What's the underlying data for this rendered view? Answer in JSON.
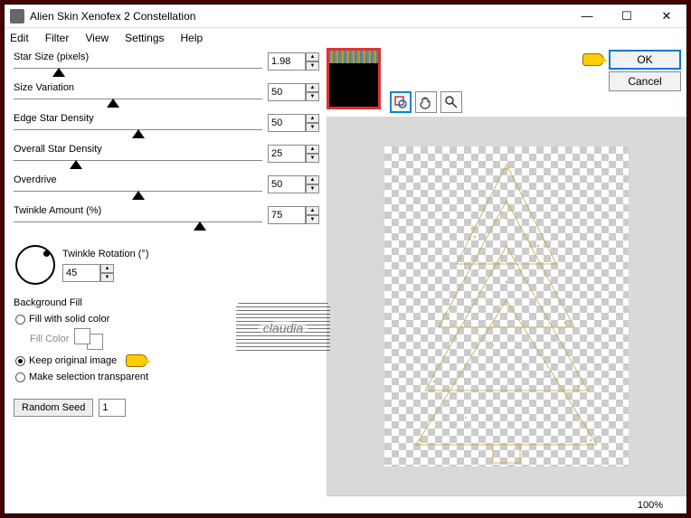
{
  "window": {
    "title": "Alien Skin Xenofex 2 Constellation"
  },
  "menu": {
    "items": [
      "Edit",
      "Filter",
      "View",
      "Settings",
      "Help"
    ]
  },
  "sliders": [
    {
      "label": "Star Size (pixels)",
      "value": "1.98",
      "pos": 18
    },
    {
      "label": "Size Variation",
      "value": "50",
      "pos": 40
    },
    {
      "label": "Edge Star Density",
      "value": "50",
      "pos": 50
    },
    {
      "label": "Overall Star Density",
      "value": "25",
      "pos": 25
    },
    {
      "label": "Overdrive",
      "value": "50",
      "pos": 50
    },
    {
      "label": "Twinkle Amount (%)",
      "value": "75",
      "pos": 75
    }
  ],
  "rotation": {
    "label": "Twinkle Rotation (°)",
    "value": "45"
  },
  "bgfill": {
    "header": "Background Fill",
    "opt_solid": "Fill with solid color",
    "fill_color_label": "Fill Color",
    "opt_keep": "Keep original image",
    "opt_transparent": "Make selection transparent",
    "selected": "keep"
  },
  "seed": {
    "button": "Random Seed",
    "value": "1"
  },
  "buttons": {
    "ok": "OK",
    "cancel": "Cancel"
  },
  "tools": {
    "t0": "zoom-fit-icon",
    "t1": "hand-icon",
    "t2": "zoom-icon"
  },
  "status": {
    "zoom": "100%"
  },
  "watermark": "claudia"
}
